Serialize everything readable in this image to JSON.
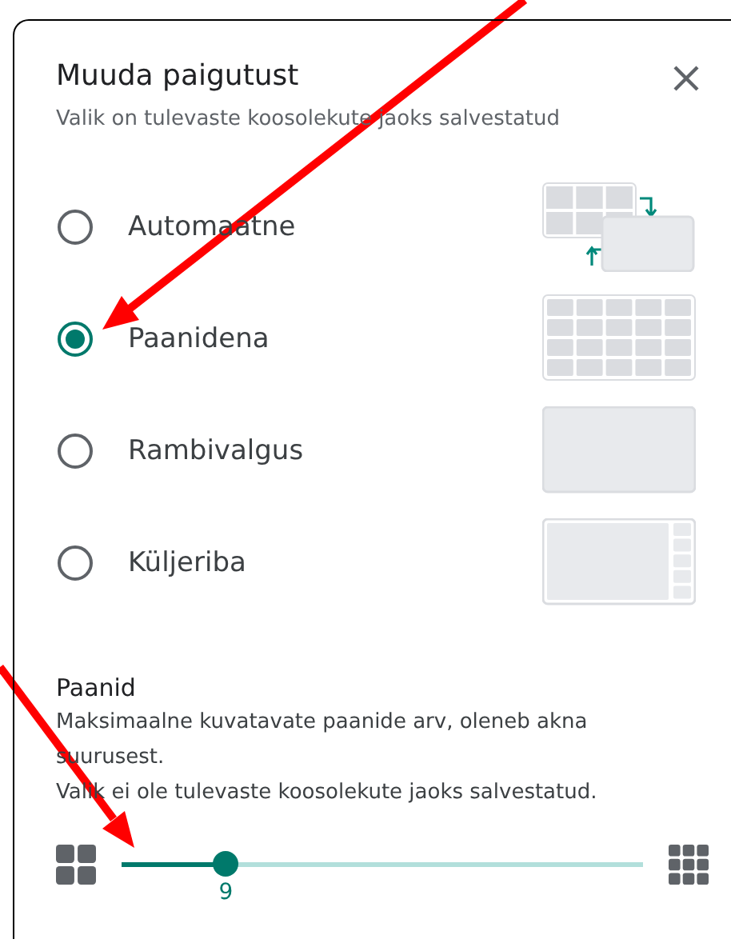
{
  "dialog": {
    "title": "Muuda paigutust",
    "subtitle": "Valik on tulevaste koosolekute jaoks salvestatud"
  },
  "layouts": [
    {
      "label": "Automaatne",
      "selected": false,
      "kind": "auto"
    },
    {
      "label": "Paanidena",
      "selected": true,
      "kind": "tiled"
    },
    {
      "label": "Rambivalgus",
      "selected": false,
      "kind": "spotlight"
    },
    {
      "label": "Küljeriba",
      "selected": false,
      "kind": "sidebar"
    }
  ],
  "tiles": {
    "heading": "Paanid",
    "description": "Maksimaalne kuvatavate paanide arv, oleneb akna suurusest.",
    "note": "Valik ei ole tulevaste koosolekute jaoks salvestatud.",
    "slider": {
      "level": 0.2,
      "reading": "9"
    }
  }
}
